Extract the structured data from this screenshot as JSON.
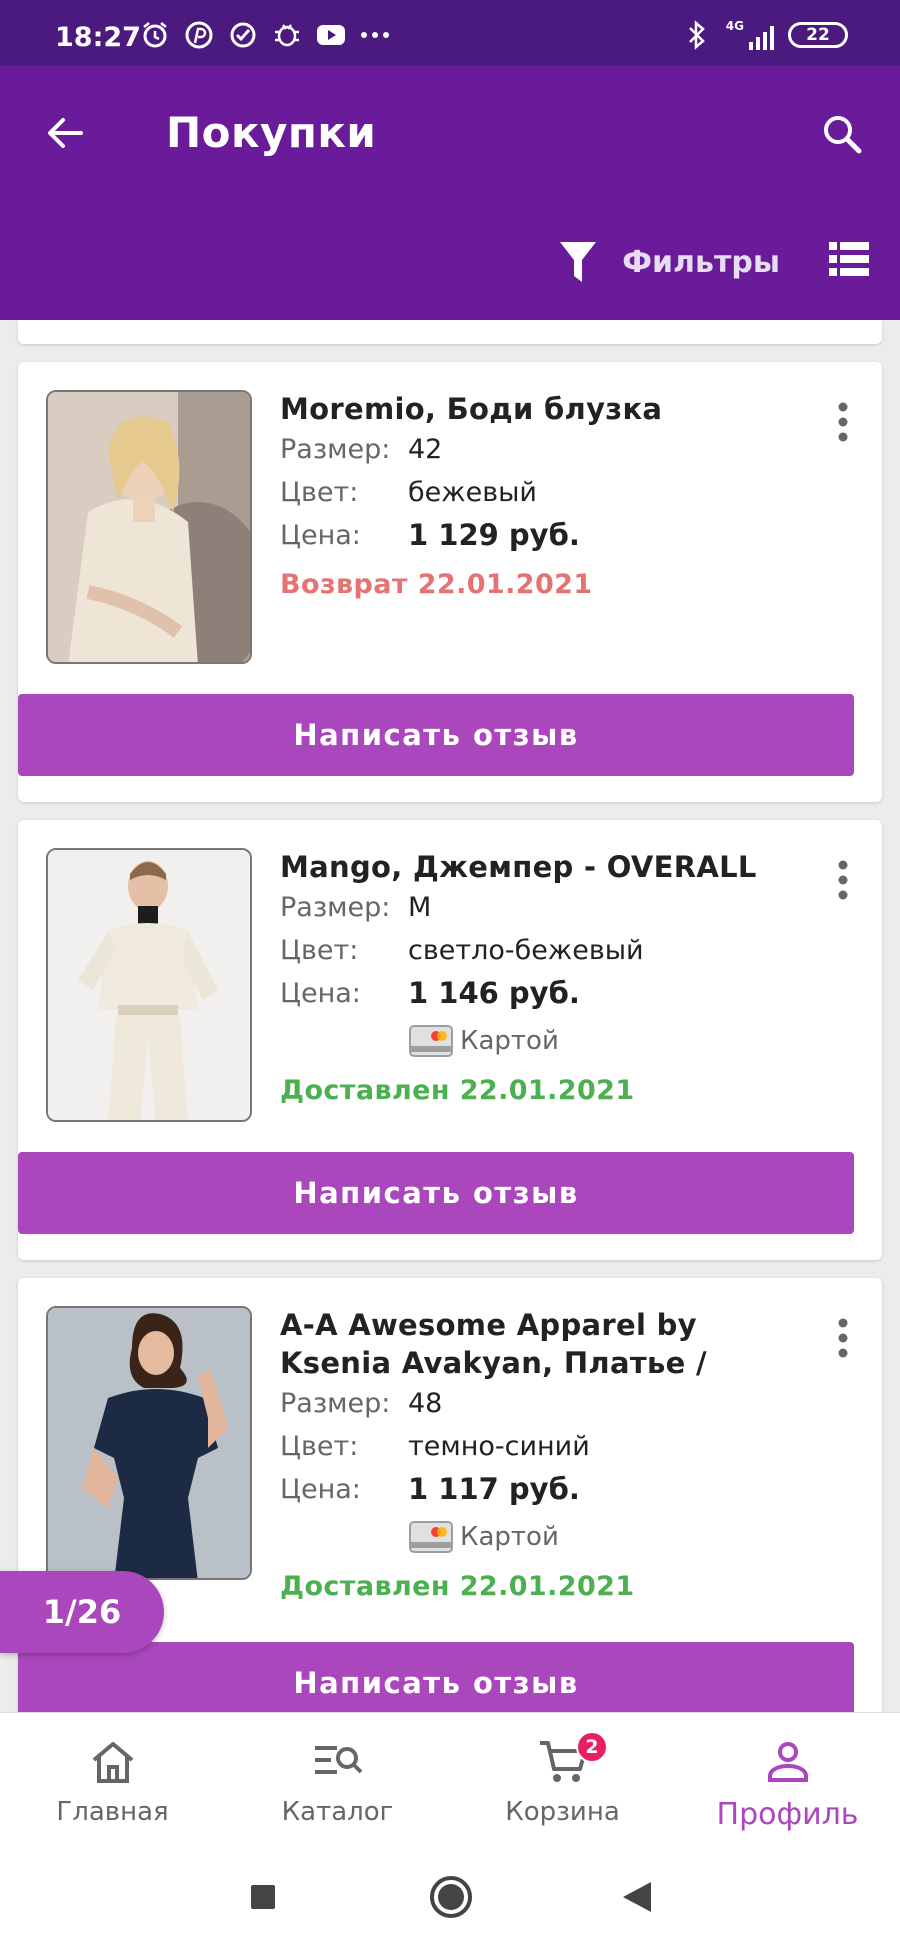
{
  "status_bar": {
    "time": "18:27",
    "network": "4G",
    "battery": "22",
    "left_icons": [
      "alarm-icon",
      "pinterest-icon",
      "check-circle-icon",
      "bug-icon",
      "youtube-icon",
      "more-dots-icon"
    ],
    "right_icons": [
      "bluetooth-icon",
      "signal-icon",
      "battery-icon"
    ]
  },
  "app_bar": {
    "title": "Покупки",
    "filter_label": "Фильтры",
    "background": "#6a1b9a",
    "status_background": "#4a1a7e"
  },
  "labels": {
    "size": "Размер:",
    "color": "Цвет:",
    "price": "Цена:",
    "review_button": "Написать отзыв",
    "payment": "Картой"
  },
  "purchases": [
    {
      "title": "Moremio, Боди блузка",
      "size": "42",
      "color": "бежевый",
      "price": "1 129 руб.",
      "status": "Возврат 22.01.2021",
      "status_type": "return"
    },
    {
      "title": "Mango, Джемпер - OVERALL",
      "size": "M",
      "color": "светло-бежевый",
      "price": "1 146 руб.",
      "payment": "Картой",
      "status": "Доставлен 22.01.2021",
      "status_type": "delivered"
    },
    {
      "title_line1": "A-A Awesome Apparel by",
      "title_line2": "Ksenia Avakyan, Платье /",
      "size": "48",
      "color": "темно-синий",
      "price": "1 117 руб.",
      "payment": "Картой",
      "status": "Доставлен 22.01.2021",
      "status_type": "delivered"
    }
  ],
  "pager": "1/26",
  "bottom_nav": [
    {
      "label": "Главная",
      "icon": "home-icon"
    },
    {
      "label": "Каталог",
      "icon": "catalog-search-icon"
    },
    {
      "label": "Корзина",
      "icon": "cart-icon",
      "badge": "2"
    },
    {
      "label": "Профиль",
      "icon": "profile-icon",
      "active": true
    }
  ],
  "colors": {
    "accent": "#ab47bc",
    "return_status": "#e57373",
    "delivered_status": "#4caf50",
    "badge": "#e91e63"
  }
}
